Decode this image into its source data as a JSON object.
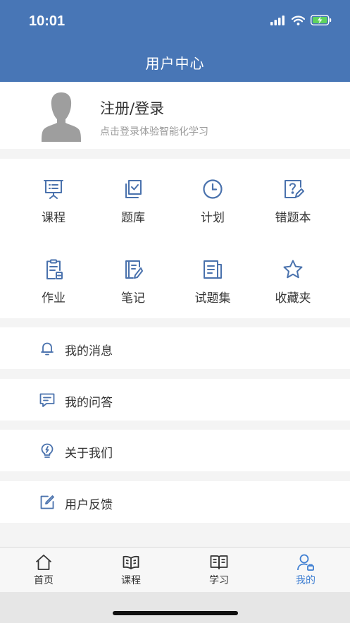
{
  "status_bar": {
    "time": "10:01"
  },
  "header": {
    "title": "用户中心"
  },
  "profile": {
    "name": "注册/登录",
    "subtitle": "点击登录体验智能化学习"
  },
  "grid": [
    {
      "label": "课程",
      "icon": "presentation-board-icon"
    },
    {
      "label": "题库",
      "icon": "question-bank-icon"
    },
    {
      "label": "计划",
      "icon": "clock-icon"
    },
    {
      "label": "错题本",
      "icon": "wrong-question-book-icon"
    },
    {
      "label": "作业",
      "icon": "clipboard-icon"
    },
    {
      "label": "笔记",
      "icon": "note-pencil-icon"
    },
    {
      "label": "试题集",
      "icon": "document-list-icon"
    },
    {
      "label": "收藏夹",
      "icon": "star-icon"
    }
  ],
  "menu": [
    {
      "label": "我的消息",
      "icon": "bell-icon"
    },
    {
      "label": "我的问答",
      "icon": "chat-bubble-icon"
    },
    {
      "label": "关于我们",
      "icon": "lightbulb-icon"
    },
    {
      "label": "用户反馈",
      "icon": "edit-icon"
    }
  ],
  "tabbar": [
    {
      "label": "首页",
      "icon": "home-icon"
    },
    {
      "label": "课程",
      "icon": "book-icon"
    },
    {
      "label": "学习",
      "icon": "open-book-icon"
    },
    {
      "label": "我的",
      "icon": "user-icon",
      "active": true
    }
  ],
  "colors": {
    "header": "#4876b6",
    "icon": "#4a72ad",
    "active_tab": "#3f7fd2"
  }
}
